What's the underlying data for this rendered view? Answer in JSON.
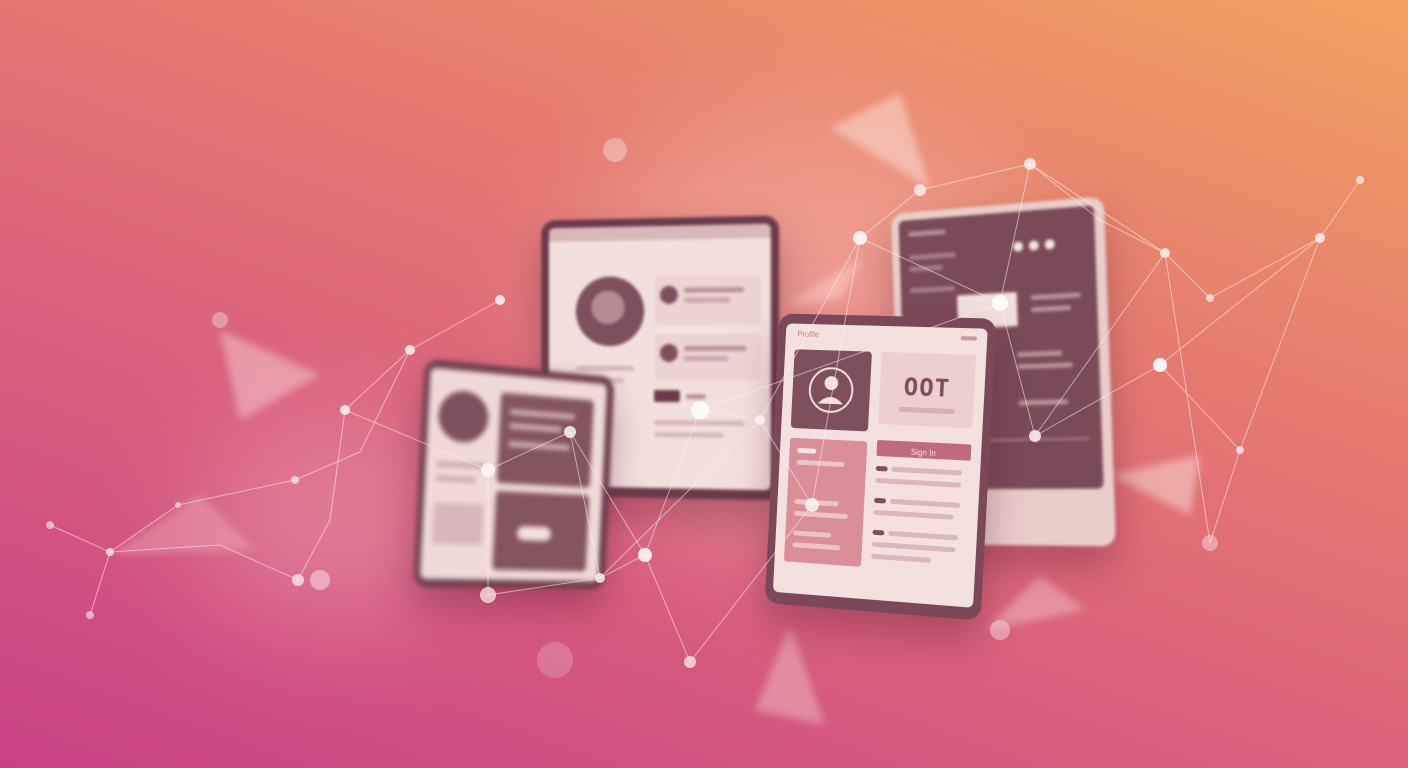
{
  "scene": {
    "gradient_colors": [
      "#c94286",
      "#d85f7d",
      "#e57a70",
      "#f2a262"
    ],
    "accent_dark": "#7e4f5d",
    "accent_light": "#f6e4e1"
  },
  "devices": {
    "tablet_front": {
      "header_text": "Profile",
      "readout": "OOT",
      "button_label": "Sign In"
    }
  }
}
